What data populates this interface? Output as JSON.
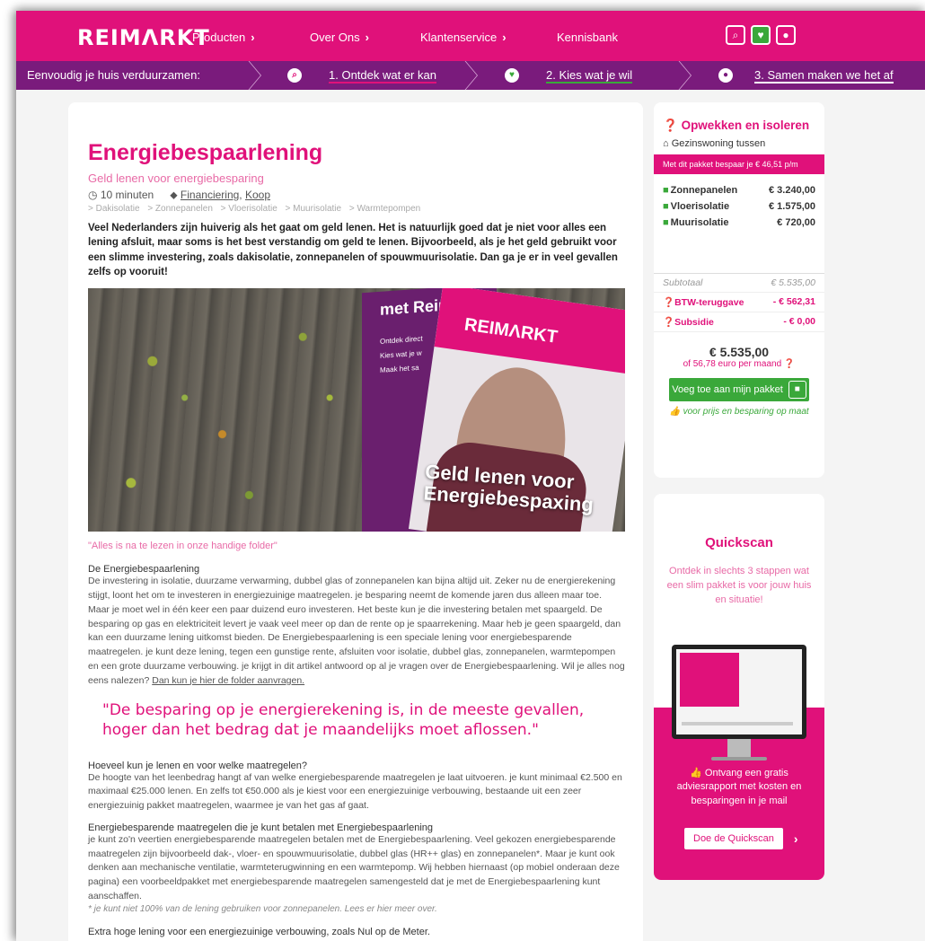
{
  "nav": {
    "logo": "REIMΛRKT",
    "items": [
      {
        "label": "Producten",
        "chevron": "›"
      },
      {
        "label": "Over Ons",
        "chevron": "›"
      },
      {
        "label": "Klantenservice",
        "chevron": "›"
      },
      {
        "label": "Kennisbank",
        "chevron": ""
      }
    ],
    "icons": [
      "search-icon",
      "heart-icon",
      "user-icon"
    ]
  },
  "steps": {
    "intro": "Eenvoudig je huis verduurzamen:",
    "items": [
      {
        "label": "1. Ontdek wat er kan",
        "icon": "search-icon"
      },
      {
        "label": "2. Kies wat je wil",
        "icon": "heart-icon"
      },
      {
        "label": "3. Samen maken we het af",
        "icon": "user-icon"
      }
    ]
  },
  "article": {
    "title": "Energiebespaarlening",
    "subtitle": "Geld lenen voor energiebesparing",
    "read_time": "10 minuten",
    "categories": [
      "Financiering",
      "Koop"
    ],
    "tags": [
      "> Dakisolatie",
      "> Zonnepanelen",
      "> Vloerisolatie",
      "> Muurisolatie",
      "> Warmtepompen"
    ],
    "lead": "Veel Nederlanders zijn huiverig als het gaat om geld lenen. Het is natuurlijk goed dat je niet voor alles een lening afsluit, maar soms is het best verstandig om geld te lenen. Bijvoorbeeld, als je het geld gebruikt voor een slimme investering, zoals dakisolatie, zonnepanelen of spouwmuurisolatie. Dan ga je er in veel gevallen zelfs op vooruit!",
    "hero": {
      "back_text": "met Reim",
      "back_list": [
        "Ontdek direct",
        "Kies wat je w",
        "Maak het sa"
      ],
      "front_logo": "REIMΛRKT",
      "front_caption": "Geld lenen voor Energiebespaxing"
    },
    "image_caption": "\"Alles is na te lezen in onze handige folder\"",
    "section1_heading": "De Energiebespaarlening",
    "section1_body": "De investering in isolatie, duurzame verwarming, dubbel glas of zonnepanelen kan bijna altijd uit. Zeker nu de energierekening stijgt, loont het om te investeren in energiezuinige maatregelen. je besparing neemt de komende jaren dus alleen maar toe. Maar je moet wel in één keer een paar duizend euro investeren. Het beste kun je die investering betalen met spaargeld. De besparing op gas en elektriciteit levert je vaak veel meer op dan de rente op je spaarrekening. Maar heb je geen spaargeld, dan kan een duurzame lening uitkomst bieden. De Energiebespaarlening is een speciale lening voor energiebesparende maatregelen. je kunt deze lening, tegen een gunstige rente, afsluiten voor isolatie, dubbel glas, zonnepanelen, warmtepompen en een grote duurzame verbouwing. je krijgt in dit artikel antwoord op al je vragen over de Energiebespaarlening. Wil je alles nog eens nalezen?",
    "section1_link": "Dan kun je hier de folder aanvragen.",
    "quote": "\"De besparing op je energierekening is, in de meeste gevallen, hoger dan het bedrag dat je maandelijks moet aflossen.\"",
    "section2_heading": "Hoeveel kun je lenen en voor welke maatregelen?",
    "section2_body": "De hoogte van het leenbedrag hangt af van welke energiebesparende maatregelen je laat uitvoeren. je kunt minimaal €2.500 en maximaal €25.000 lenen. En zelfs tot €50.000 als je kiest voor een energiezuinige verbouwing, bestaande uit een zeer energiezuinig pakket maatregelen, waarmee je van het gas af gaat.",
    "section3_heading": "Energiebesparende maatregelen die je kunt betalen met Energiebespaarlening",
    "section3_body": "je kunt zo'n veertien energiebesparende maatregelen betalen met de Energiebespaarlening. Veel gekozen energiebesparende maatregelen zijn bijvoorbeeld dak-, vloer- en spouwmuurisolatie, dubbel glas (HR++ glas) en zonnepanelen*. Maar je kunt ook denken aan mechanische ventilatie, warmteterugwinning en een warmtepomp. Wij hebben hiernaast (op mobiel onderaan deze pagina) een voorbeeldpakket met energiebesparende maatregelen samengesteld dat je met de Energiebespaarlening kunt aanschaffen.",
    "note": "* je kunt niet 100% van de lening gebruiken voor zonnepanelen. Lees er hier meer over.",
    "section4_heading": "Extra hoge lening voor een energiezuinige verbouwing, zoals Nul op de Meter."
  },
  "package": {
    "title": "Opwekken en isoleren",
    "home_type": "Gezinswoning tussen",
    "banner": "Met dit pakket bespaar je € 46,51 p/m",
    "items": [
      {
        "label": "Zonnepanelen",
        "price": "€ 3.240,00"
      },
      {
        "label": "Vloerisolatie",
        "price": "€ 1.575,00"
      },
      {
        "label": "Muurisolatie",
        "price": "€ 720,00"
      }
    ],
    "subtotal_label": "Subtotaal",
    "subtotal_value": "€ 5.535,00",
    "btw_label": "BTW-teruggave",
    "btw_value": "- € 562,31",
    "subsidy_label": "Subsidie",
    "subsidy_value": "- € 0,00",
    "total": "€ 5.535,00",
    "per_month": "of 56,78 euro per maand",
    "add_button": "Voeg toe aan mijn pakket",
    "hint": "voor prijs en besparing op maat"
  },
  "quickscan": {
    "title": "Quickscan",
    "subtitle": "Ontdek in slechts 3 stappen wat een slim pakket is voor jouw huis en situatie!",
    "offer": "Ontvang een gratis adviesrapport met kosten en besparingen in je mail",
    "button": "Doe de Quickscan",
    "chevron": "›"
  },
  "colors": {
    "brand_pink": "#e0117a",
    "brand_purple": "#7a1b7c",
    "accent_green": "#3aa83a"
  }
}
